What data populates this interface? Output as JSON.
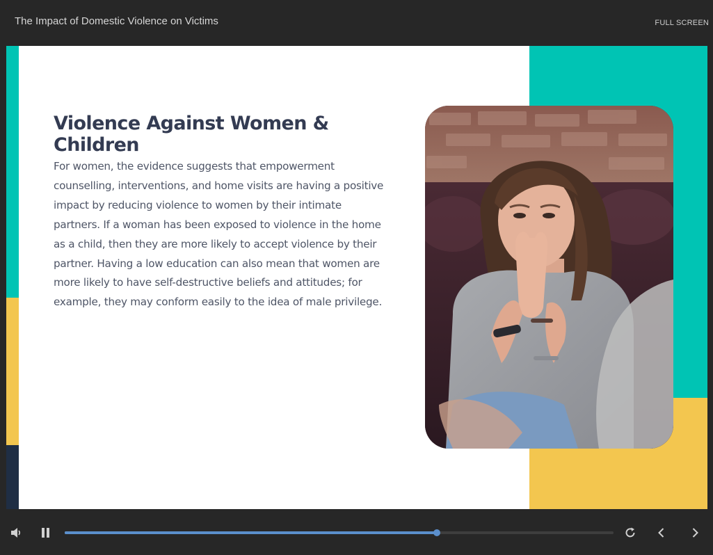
{
  "header": {
    "title": "The Impact of Domestic Violence on Victims",
    "fullscreen_label": "FULL SCREEN"
  },
  "slide": {
    "heading": "Violence Against Women & Children",
    "body": "For women, the evidence suggests that empowerment counselling, interventions, and home visits are having a positive impact by reducing violence to women by their intimate partners. If a woman has been exposed to violence in the home as a child, then they are more likely to accept violence by their partner. Having a low education can also mean that women are more likely to have self-destructive beliefs and attitudes; for example, they may conform easily to the idea of male privilege.",
    "accent_colors": {
      "teal": "#00c4b4",
      "yellow": "#f3c64f",
      "navy": "#1f2e44"
    }
  },
  "player": {
    "progress": 0.678,
    "buffered": 0.62,
    "icons": [
      "volume-icon",
      "pause-icon",
      "replay-icon",
      "previous-icon",
      "next-icon"
    ],
    "accent": "#5b8fcc"
  }
}
